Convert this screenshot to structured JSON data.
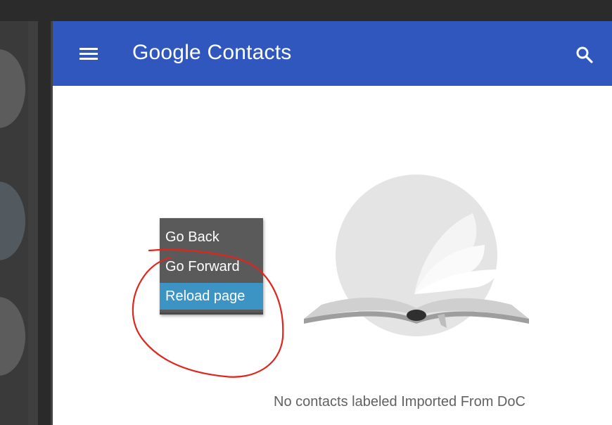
{
  "app": {
    "title_part1": "Google",
    "title_part2": "Contacts"
  },
  "icons": {
    "menu": "hamburger-menu-icon",
    "search": "search-icon",
    "empty_state": "open-book-illustration"
  },
  "empty_state": {
    "message": "No contacts labeled Imported From DoC"
  },
  "context_menu": {
    "items": [
      {
        "label": "Go Back"
      },
      {
        "label": "Go Forward"
      },
      {
        "label": "Reload page",
        "highlighted": true
      }
    ]
  },
  "colors": {
    "app_bar": "#2f57bd",
    "menu_bg": "#5a5a5a",
    "menu_highlight": "#3b94c4",
    "annotation": "#e0261c"
  }
}
